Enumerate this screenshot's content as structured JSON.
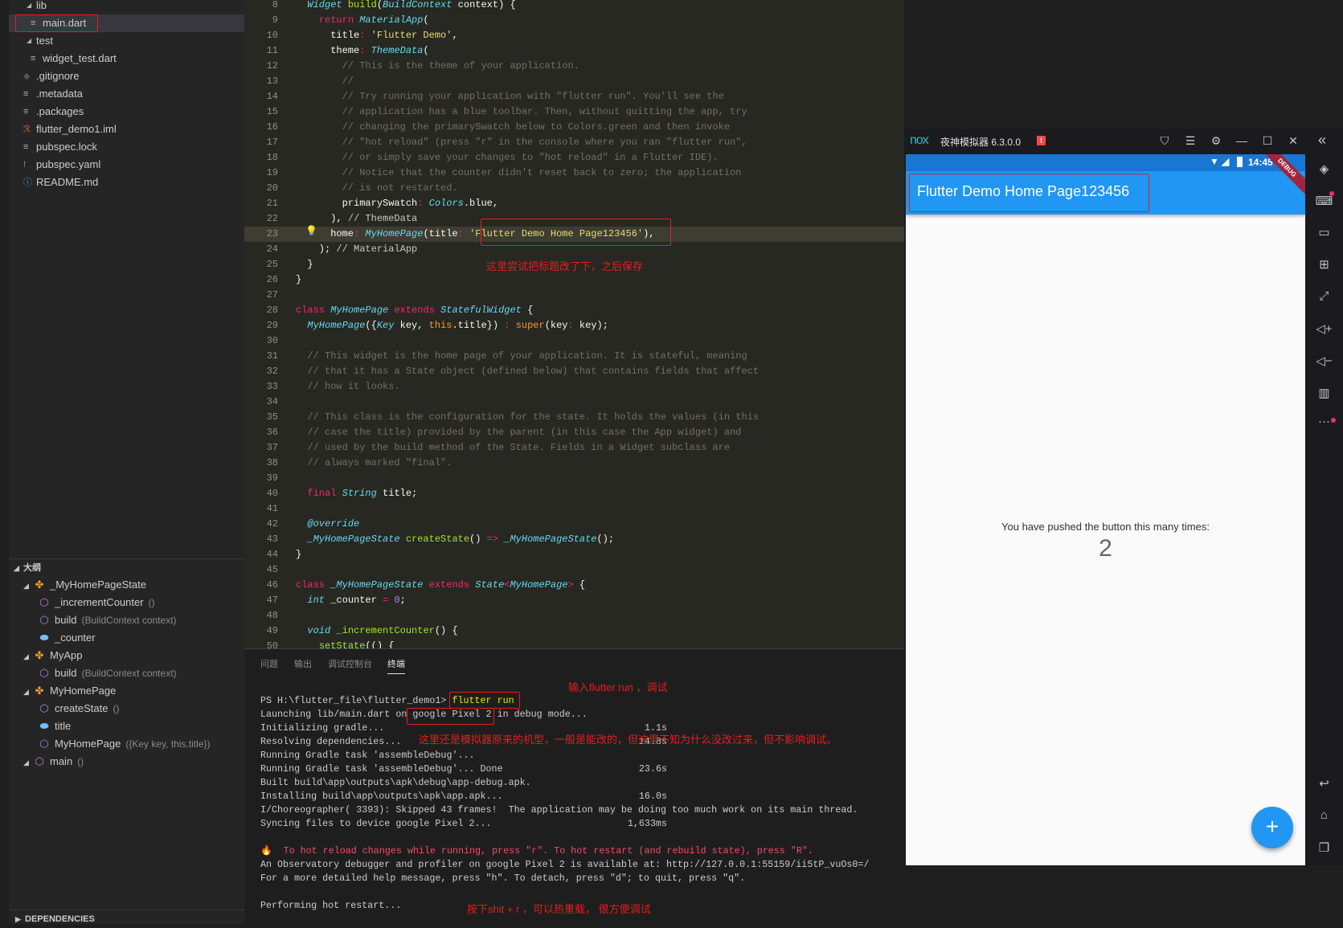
{
  "explorer": {
    "items": [
      {
        "label": "lib",
        "icon": "chevron-expanded-icon",
        "kind": "folder"
      },
      {
        "label": "main.dart",
        "icon": "file-lines-icon",
        "kind": "file",
        "selected": true
      },
      {
        "label": "test",
        "icon": "chevron-expanded-icon",
        "kind": "folder"
      },
      {
        "label": "widget_test.dart",
        "icon": "file-lines-icon",
        "kind": "file"
      },
      {
        "label": ".gitignore",
        "icon": "git-diamond-icon",
        "kind": "file"
      },
      {
        "label": ".metadata",
        "icon": "file-lines-icon",
        "kind": "file"
      },
      {
        "label": ".packages",
        "icon": "file-lines-icon",
        "kind": "file"
      },
      {
        "label": "flutter_demo1.iml",
        "icon": "rss-icon",
        "kind": "file"
      },
      {
        "label": "pubspec.lock",
        "icon": "file-lines-icon",
        "kind": "file"
      },
      {
        "label": "pubspec.yaml",
        "icon": "exclamation-icon",
        "kind": "file"
      },
      {
        "label": "README.md",
        "icon": "info-icon",
        "kind": "file"
      }
    ]
  },
  "outline": {
    "title": "大纲",
    "items": [
      {
        "label": "_MyHomePageState",
        "detail": "",
        "kind": "class",
        "depth": 0
      },
      {
        "label": "_incrementCounter",
        "detail": "()",
        "kind": "method",
        "depth": 1
      },
      {
        "label": "build",
        "detail": "(BuildContext context)",
        "kind": "method",
        "depth": 1
      },
      {
        "label": "_counter",
        "detail": "",
        "kind": "field",
        "depth": 1
      },
      {
        "label": "MyApp",
        "detail": "",
        "kind": "class",
        "depth": 0
      },
      {
        "label": "build",
        "detail": "(BuildContext context)",
        "kind": "method",
        "depth": 1
      },
      {
        "label": "MyHomePage",
        "detail": "",
        "kind": "class",
        "depth": 0
      },
      {
        "label": "createState",
        "detail": "()",
        "kind": "method",
        "depth": 1
      },
      {
        "label": "title",
        "detail": "",
        "kind": "field",
        "depth": 1
      },
      {
        "label": "MyHomePage",
        "detail": "({Key key, this.title})",
        "kind": "method",
        "depth": 1
      },
      {
        "label": "main",
        "detail": "()",
        "kind": "method",
        "depth": 0
      }
    ]
  },
  "dependencies_label": "DEPENDENCIES",
  "editor": {
    "current_line": 23,
    "lines": [
      {
        "n": "8",
        "t": [
          [
            "pl",
            "  "
          ],
          [
            "ty",
            "Widget"
          ],
          [
            "pl",
            " "
          ],
          [
            "fn",
            "build"
          ],
          [
            "pl",
            "("
          ],
          [
            "ty",
            "BuildContext"
          ],
          [
            "pl",
            " context) {"
          ]
        ]
      },
      {
        "n": "9",
        "t": [
          [
            "pl",
            "    "
          ],
          [
            "kw",
            "return"
          ],
          [
            "pl",
            " "
          ],
          [
            "ty",
            "MaterialApp"
          ],
          [
            "pl",
            "("
          ]
        ]
      },
      {
        "n": "10",
        "t": [
          [
            "pl",
            "      title"
          ],
          [
            "kw",
            ":"
          ],
          [
            "pl",
            " "
          ],
          [
            "str",
            "'Flutter Demo'"
          ],
          [
            "pl",
            ","
          ]
        ]
      },
      {
        "n": "11",
        "t": [
          [
            "pl",
            "      theme"
          ],
          [
            "kw",
            ":"
          ],
          [
            "pl",
            " "
          ],
          [
            "ty",
            "ThemeData"
          ],
          [
            "pl",
            "("
          ]
        ]
      },
      {
        "n": "12",
        "t": [
          [
            "cm",
            "        // This is the theme of your application."
          ]
        ]
      },
      {
        "n": "13",
        "t": [
          [
            "cm",
            "        //"
          ]
        ]
      },
      {
        "n": "14",
        "t": [
          [
            "cm",
            "        // Try running your application with \"flutter run\". You'll see the"
          ]
        ]
      },
      {
        "n": "15",
        "t": [
          [
            "cm",
            "        // application has a blue toolbar. Then, without quitting the app, try"
          ]
        ]
      },
      {
        "n": "16",
        "t": [
          [
            "cm",
            "        // changing the primarySwatch below to Colors.green and then invoke"
          ]
        ]
      },
      {
        "n": "17",
        "t": [
          [
            "cm",
            "        // \"hot reload\" (press \"r\" in the console where you ran \"flutter run\","
          ]
        ]
      },
      {
        "n": "18",
        "t": [
          [
            "cm",
            "        // or simply save your changes to \"hot reload\" in a Flutter IDE)."
          ]
        ]
      },
      {
        "n": "19",
        "t": [
          [
            "cm",
            "        // Notice that the counter didn't reset back to zero; the application"
          ]
        ]
      },
      {
        "n": "20",
        "t": [
          [
            "cm",
            "        // is not restarted."
          ]
        ]
      },
      {
        "n": "21",
        "t": [
          [
            "pl",
            "        primarySwatch"
          ],
          [
            "kw",
            ":"
          ],
          [
            "pl",
            " "
          ],
          [
            "ty",
            "Colors"
          ],
          [
            "pl",
            ".blue,"
          ]
        ]
      },
      {
        "n": "22",
        "t": [
          [
            "pl",
            "      ), "
          ],
          [
            "lb",
            "// ThemeData"
          ]
        ]
      },
      {
        "n": "23",
        "t": [
          [
            "pl",
            "      home"
          ],
          [
            "kw",
            ":"
          ],
          [
            "pl",
            " "
          ],
          [
            "ty",
            "MyHomePage"
          ],
          [
            "pl",
            "(title"
          ],
          [
            "kw",
            ":"
          ],
          [
            "pl",
            " "
          ],
          [
            "str",
            "'Flutter Demo Home Page123456'"
          ],
          [
            "pl",
            "),"
          ]
        ]
      },
      {
        "n": "24",
        "t": [
          [
            "pl",
            "    ); "
          ],
          [
            "lb",
            "// MaterialApp"
          ]
        ]
      },
      {
        "n": "25",
        "t": [
          [
            "pl",
            "  }"
          ]
        ]
      },
      {
        "n": "26",
        "t": [
          [
            "pl",
            "}"
          ]
        ]
      },
      {
        "n": "27",
        "t": []
      },
      {
        "n": "28",
        "t": [
          [
            "kw",
            "class"
          ],
          [
            "pl",
            " "
          ],
          [
            "ty",
            "MyHomePage"
          ],
          [
            "pl",
            " "
          ],
          [
            "kw",
            "extends"
          ],
          [
            "pl",
            " "
          ],
          [
            "ty",
            "StatefulWidget"
          ],
          [
            "pl",
            " {"
          ]
        ]
      },
      {
        "n": "29",
        "t": [
          [
            "pl",
            "  "
          ],
          [
            "ty",
            "MyHomePage"
          ],
          [
            "pl",
            "({"
          ],
          [
            "ty",
            "Key"
          ],
          [
            "pl",
            " key, "
          ],
          [
            "or",
            "this"
          ],
          [
            "pl",
            ".title}) "
          ],
          [
            "kw",
            ":"
          ],
          [
            "pl",
            " "
          ],
          [
            "or",
            "super"
          ],
          [
            "pl",
            "(key"
          ],
          [
            "kw",
            ":"
          ],
          [
            "pl",
            " key);"
          ]
        ]
      },
      {
        "n": "30",
        "t": []
      },
      {
        "n": "31",
        "t": [
          [
            "cm",
            "  // This widget is the home page of your application. It is stateful, meaning"
          ]
        ]
      },
      {
        "n": "32",
        "t": [
          [
            "cm",
            "  // that it has a State object (defined below) that contains fields that affect"
          ]
        ]
      },
      {
        "n": "33",
        "t": [
          [
            "cm",
            "  // how it looks."
          ]
        ]
      },
      {
        "n": "34",
        "t": []
      },
      {
        "n": "35",
        "t": [
          [
            "cm",
            "  // This class is the configuration for the state. It holds the values (in this"
          ]
        ]
      },
      {
        "n": "36",
        "t": [
          [
            "cm",
            "  // case the title) provided by the parent (in this case the App widget) and"
          ]
        ]
      },
      {
        "n": "37",
        "t": [
          [
            "cm",
            "  // used by the build method of the State. Fields in a Widget subclass are"
          ]
        ]
      },
      {
        "n": "38",
        "t": [
          [
            "cm",
            "  // always marked \"final\"."
          ]
        ]
      },
      {
        "n": "39",
        "t": []
      },
      {
        "n": "40",
        "t": [
          [
            "pl",
            "  "
          ],
          [
            "kw",
            "final"
          ],
          [
            "pl",
            " "
          ],
          [
            "ty",
            "String"
          ],
          [
            "pl",
            " title;"
          ]
        ]
      },
      {
        "n": "41",
        "t": []
      },
      {
        "n": "42",
        "t": [
          [
            "pl",
            "  "
          ],
          [
            "an",
            "@override"
          ]
        ]
      },
      {
        "n": "43",
        "t": [
          [
            "pl",
            "  "
          ],
          [
            "ty",
            "_MyHomePageState"
          ],
          [
            "pl",
            " "
          ],
          [
            "fn",
            "createState"
          ],
          [
            "pl",
            "() "
          ],
          [
            "kw",
            "=>"
          ],
          [
            "pl",
            " "
          ],
          [
            "ty",
            "_MyHomePageState"
          ],
          [
            "pl",
            "();"
          ]
        ]
      },
      {
        "n": "44",
        "t": [
          [
            "pl",
            "}"
          ]
        ]
      },
      {
        "n": "45",
        "t": []
      },
      {
        "n": "46",
        "t": [
          [
            "kw",
            "class"
          ],
          [
            "pl",
            " "
          ],
          [
            "ty",
            "_MyHomePageState"
          ],
          [
            "pl",
            " "
          ],
          [
            "kw",
            "extends"
          ],
          [
            "pl",
            " "
          ],
          [
            "ty",
            "State"
          ],
          [
            "kw",
            "<"
          ],
          [
            "ty",
            "MyHomePage"
          ],
          [
            "kw",
            ">"
          ],
          [
            "pl",
            " {"
          ]
        ]
      },
      {
        "n": "47",
        "t": [
          [
            "pl",
            "  "
          ],
          [
            "ty",
            "int"
          ],
          [
            "pl",
            " _counter "
          ],
          [
            "kw",
            "="
          ],
          [
            "pl",
            " "
          ],
          [
            "num",
            "0"
          ],
          [
            "pl",
            ";"
          ]
        ]
      },
      {
        "n": "48",
        "t": []
      },
      {
        "n": "49",
        "t": [
          [
            "pl",
            "  "
          ],
          [
            "ty",
            "void"
          ],
          [
            "pl",
            " "
          ],
          [
            "fn",
            "_incrementCounter"
          ],
          [
            "pl",
            "() {"
          ]
        ]
      },
      {
        "n": "50",
        "t": [
          [
            "pl",
            "    "
          ],
          [
            "fn",
            "setState"
          ],
          [
            "pl",
            "(() {"
          ]
        ]
      }
    ]
  },
  "panel": {
    "tabs": [
      {
        "label": "问题",
        "active": false
      },
      {
        "label": "输出",
        "active": false
      },
      {
        "label": "调试控制台",
        "active": false
      },
      {
        "label": "终端",
        "active": true
      }
    ],
    "terminal": {
      "prompt": "PS H:\\flutter_file\\flutter_demo1> ",
      "command": "flutter run",
      "lines": [
        {
          "text": "Launching lib/main.dart on google Pixel 2 in debug mode...",
          "time": ""
        },
        {
          "text": "Initializing gradle...",
          "time": "1.1s"
        },
        {
          "text": "Resolving dependencies...",
          "time": "14.8s"
        },
        {
          "text": "Running Gradle task 'assembleDebug'...",
          "time": ""
        },
        {
          "text": "Running Gradle task 'assembleDebug'... Done",
          "time": "23.6s"
        },
        {
          "text": "Built build\\app\\outputs\\apk\\debug\\app-debug.apk.",
          "time": ""
        },
        {
          "text": "Installing build\\app\\outputs\\apk\\app.apk...",
          "time": "16.0s"
        },
        {
          "text": "I/Choreographer( 3393): Skipped 43 frames!  The application may be doing too much work on its main thread.",
          "time": ""
        },
        {
          "text": "Syncing files to device google Pixel 2...",
          "time": "1,633ms"
        },
        {
          "text": "",
          "time": ""
        },
        {
          "text": "🔥  To hot reload changes while running, press \"r\". To hot restart (and rebuild state), press \"R\".",
          "time": "",
          "hot": true
        },
        {
          "text": "An Observatory debugger and profiler on google Pixel 2 is available at: http://127.0.0.1:55159/ii5tP_vuOs0=/",
          "time": ""
        },
        {
          "text": "For a more detailed help message, press \"h\". To detach, press \"d\"; to quit, press \"q\".",
          "time": ""
        },
        {
          "text": "",
          "time": ""
        },
        {
          "text": "Performing hot restart...",
          "time": ""
        }
      ]
    }
  },
  "annotations": {
    "title_changed": "这里尝试把标题改了下，之后保存",
    "run_command": "输入flutter run ，调试",
    "device_model": "这里还是模拟器原来的机型，一般是能改的，但这里不知为什么没改过来，但不影响调试。",
    "hot_reload": "按下shit + r ，可以热重载， 很方便调试",
    "highlight_color": "#e02020"
  },
  "emulator": {
    "logo": "nox",
    "title": "夜神模拟器 6.3.0.0",
    "status_time": "14:45",
    "debug_banner": "DEBUG",
    "app_bar_title": "Flutter Demo Home Page123456",
    "counter_label": "You have pushed the button this many times:",
    "counter_value": "2",
    "fab_label": "+",
    "primary_color": "#2196f3",
    "status_bar_color": "#1976d2"
  }
}
